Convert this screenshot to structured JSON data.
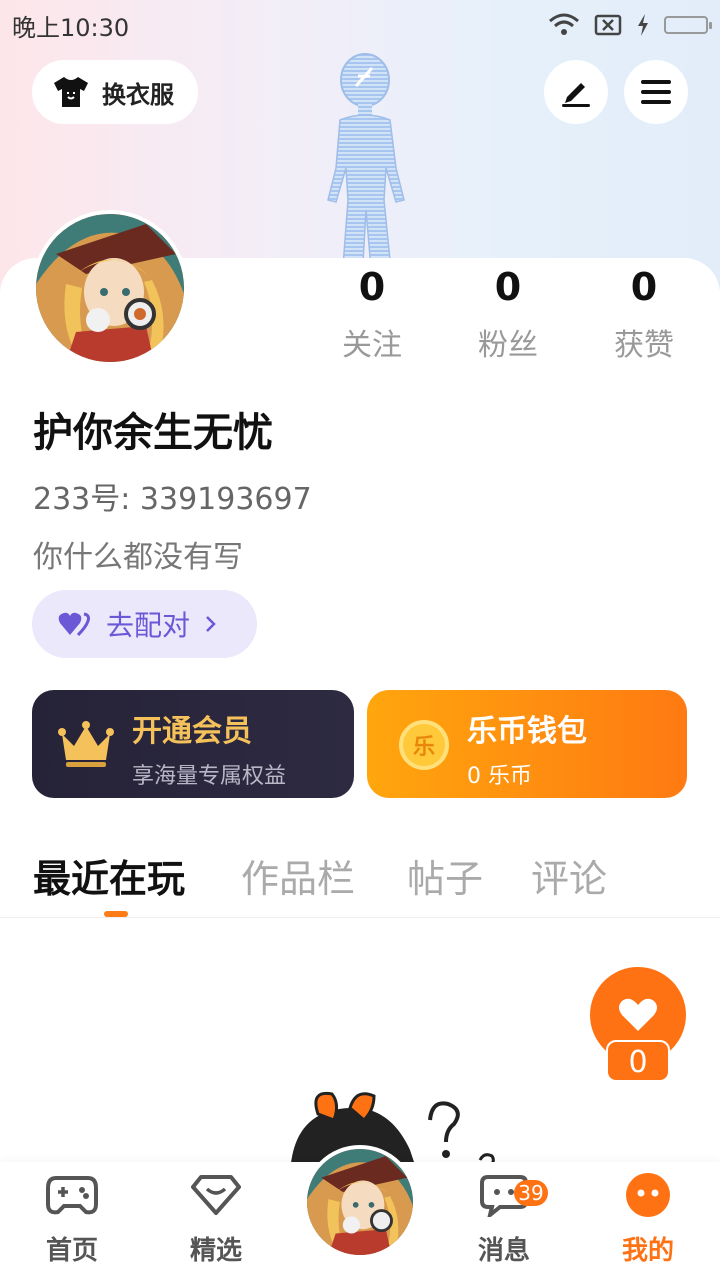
{
  "status_bar": {
    "time": "晚上10:30"
  },
  "header": {
    "dress_button_label": "换衣服",
    "edit_icon": "pen-icon",
    "menu_icon": "hamburger-icon"
  },
  "profile": {
    "stats": [
      {
        "value": "0",
        "label": "关注"
      },
      {
        "value": "0",
        "label": "粉丝"
      },
      {
        "value": "0",
        "label": "获赞"
      }
    ],
    "username": "护你余生无忧",
    "uid": "233号: 339193697",
    "bio": "你什么都没有写",
    "match_button_label": "去配对"
  },
  "vip_card": {
    "title": "开通会员",
    "subtitle": "享海量专属权益"
  },
  "wallet_card": {
    "title": "乐币钱包",
    "subtitle": "0 乐币",
    "coin_glyph": "乐"
  },
  "tabs": [
    {
      "label": "最近在玩",
      "active": true
    },
    {
      "label": "作品栏",
      "active": false
    },
    {
      "label": "帖子",
      "active": false
    },
    {
      "label": "评论",
      "active": false
    }
  ],
  "like_float": {
    "count": "0"
  },
  "bottom_nav": {
    "items": [
      {
        "label": "首页",
        "icon": "gamepad-icon"
      },
      {
        "label": "精选",
        "icon": "heart-box-icon"
      },
      {
        "label": "消息",
        "icon": "chat-icon",
        "badge": "39"
      },
      {
        "label": "我的",
        "icon": "face-icon",
        "active": true
      }
    ]
  },
  "colors": {
    "accent": "#ff7214",
    "match": "#6a58d6",
    "vip_gold": "#f5c15a"
  }
}
